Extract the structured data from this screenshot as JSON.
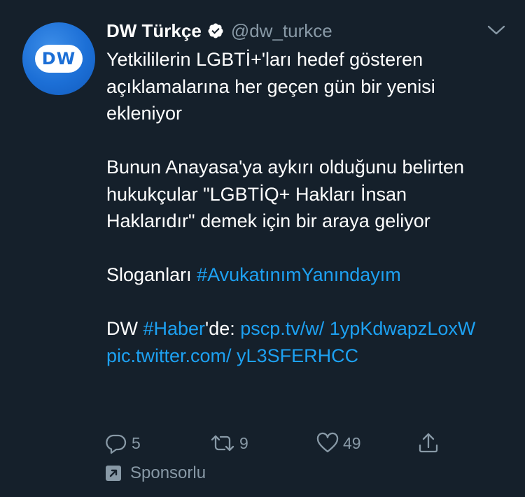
{
  "colors": {
    "background": "#15202b",
    "text_primary": "#ffffff",
    "text_secondary": "#8899a6",
    "link": "#1da1f2",
    "avatar": "#1c6fd6"
  },
  "tweet": {
    "avatar": {
      "logo_text": "DW",
      "icon": "dw-logo"
    },
    "display_name": "DW Türkçe",
    "verified_icon": "verified-badge-icon",
    "handle": "@dw_turkce",
    "menu_icon": "chevron-down-icon",
    "paragraph1": "Yetkililerin LGBTİ+'ları hedef gösteren açıklamalarına her geçen gün bir yenisi ekleniyor",
    "paragraph2": "Bunun Anayasa'ya aykırı olduğunu belirten hukukçular \"LGBTİQ+ Hakları İnsan Haklarıdır\" demek için bir araya geliyor",
    "paragraph3": {
      "prefix": "Sloganları ",
      "hashtag": "#AvukatınımYanındayım"
    },
    "paragraph4": {
      "prefix": "DW ",
      "hashtag": "#Haber",
      "middle": "'de: ",
      "link1": "pscp.tv/w/ 1ypKdwapzLoxW",
      "space": " ",
      "link2": "pic.twitter.com/ yL3SFERHCC"
    }
  },
  "actions": {
    "reply": {
      "icon": "reply-icon",
      "count": "5"
    },
    "retweet": {
      "icon": "retweet-icon",
      "count": "9"
    },
    "like": {
      "icon": "heart-icon",
      "count": "49"
    },
    "share": {
      "icon": "share-icon"
    }
  },
  "sponsor": {
    "icon": "promoted-icon",
    "label": "Sponsorlu"
  }
}
